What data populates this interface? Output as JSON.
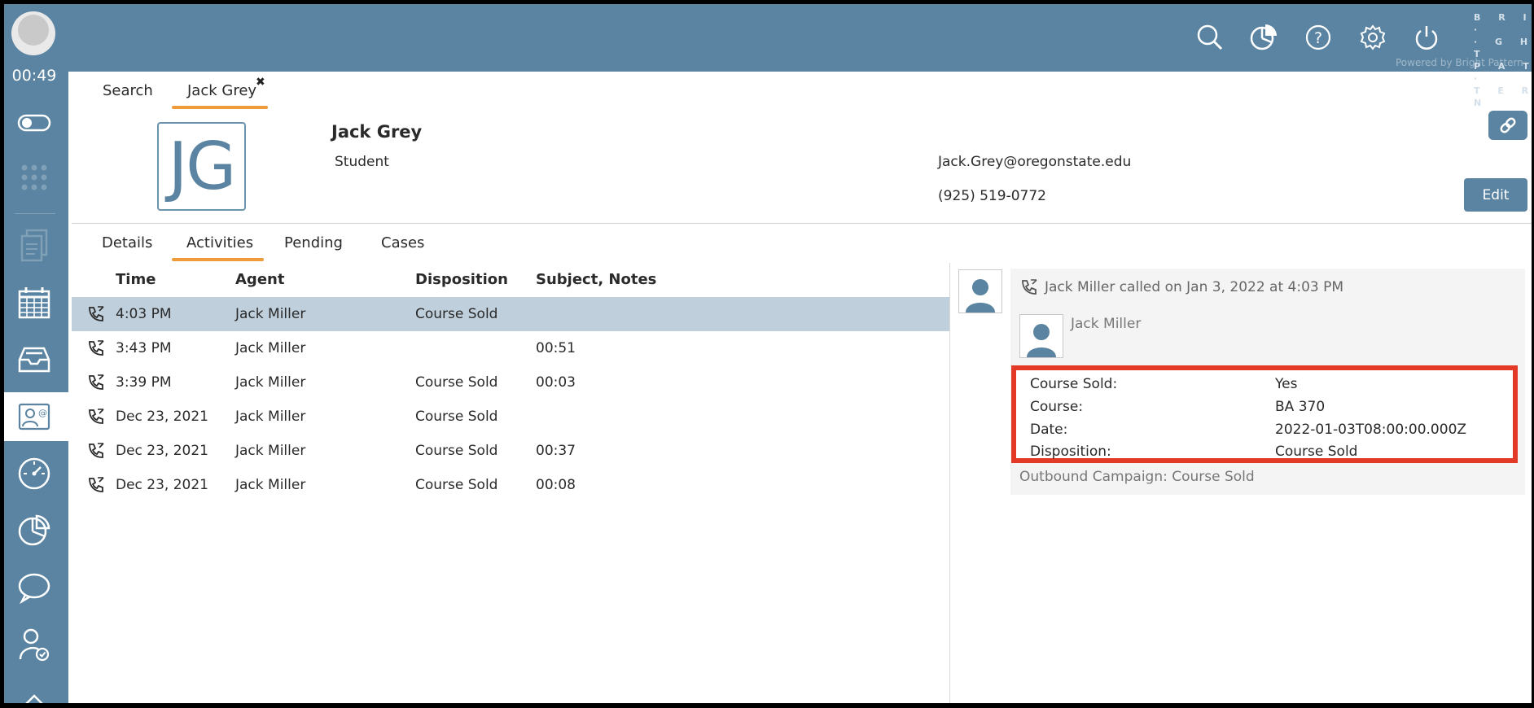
{
  "sidebar": {
    "timer": "00:49"
  },
  "topbar": {
    "brand": "BRI·GHT·PAT·TERN",
    "powered_by": "Powered by Bright Pattern"
  },
  "main_tabs": [
    {
      "label": "Search"
    },
    {
      "label": "Jack Grey"
    }
  ],
  "contact": {
    "initials": "JG",
    "name": "Jack Grey",
    "role": "Student",
    "email": "Jack.Grey@oregonstate.edu",
    "phone": "(925) 519-0772",
    "edit_label": "Edit"
  },
  "sub_tabs": [
    {
      "label": "Details"
    },
    {
      "label": "Activities"
    },
    {
      "label": "Pending"
    },
    {
      "label": "Cases"
    }
  ],
  "table": {
    "headers": [
      "Time",
      "Agent",
      "Disposition",
      "Subject, Notes"
    ],
    "rows": [
      {
        "time": "4:03 PM",
        "agent": "Jack Miller",
        "disposition": "Course Sold",
        "notes": ""
      },
      {
        "time": "3:43 PM",
        "agent": "Jack Miller",
        "disposition": "",
        "notes": "00:51"
      },
      {
        "time": "3:39 PM",
        "agent": "Jack Miller",
        "disposition": "Course Sold",
        "notes": "00:03"
      },
      {
        "time": "Dec 23, 2021",
        "agent": "Jack Miller",
        "disposition": "Course Sold",
        "notes": ""
      },
      {
        "time": "Dec 23, 2021",
        "agent": "Jack Miller",
        "disposition": "Course Sold",
        "notes": "00:37"
      },
      {
        "time": "Dec 23, 2021",
        "agent": "Jack Miller",
        "disposition": "Course Sold",
        "notes": "00:08"
      }
    ]
  },
  "detail": {
    "header": "Jack Miller called on Jan 3, 2022 at 4:03 PM",
    "agent": "Jack Miller",
    "fields": [
      {
        "label": "Course Sold:",
        "value": "Yes"
      },
      {
        "label": "Course:",
        "value": "BA 370"
      },
      {
        "label": "Date:",
        "value": "2022-01-03T08:00:00.000Z"
      },
      {
        "label": "Disposition:",
        "value": "Course Sold"
      }
    ],
    "campaign": "Outbound Campaign: Course Sold"
  },
  "colors": {
    "brand": "#5a84a1",
    "accent_tab": "#ef9b3a",
    "selected_row": "#bfcfdb",
    "highlight_border": "#e23a26"
  }
}
